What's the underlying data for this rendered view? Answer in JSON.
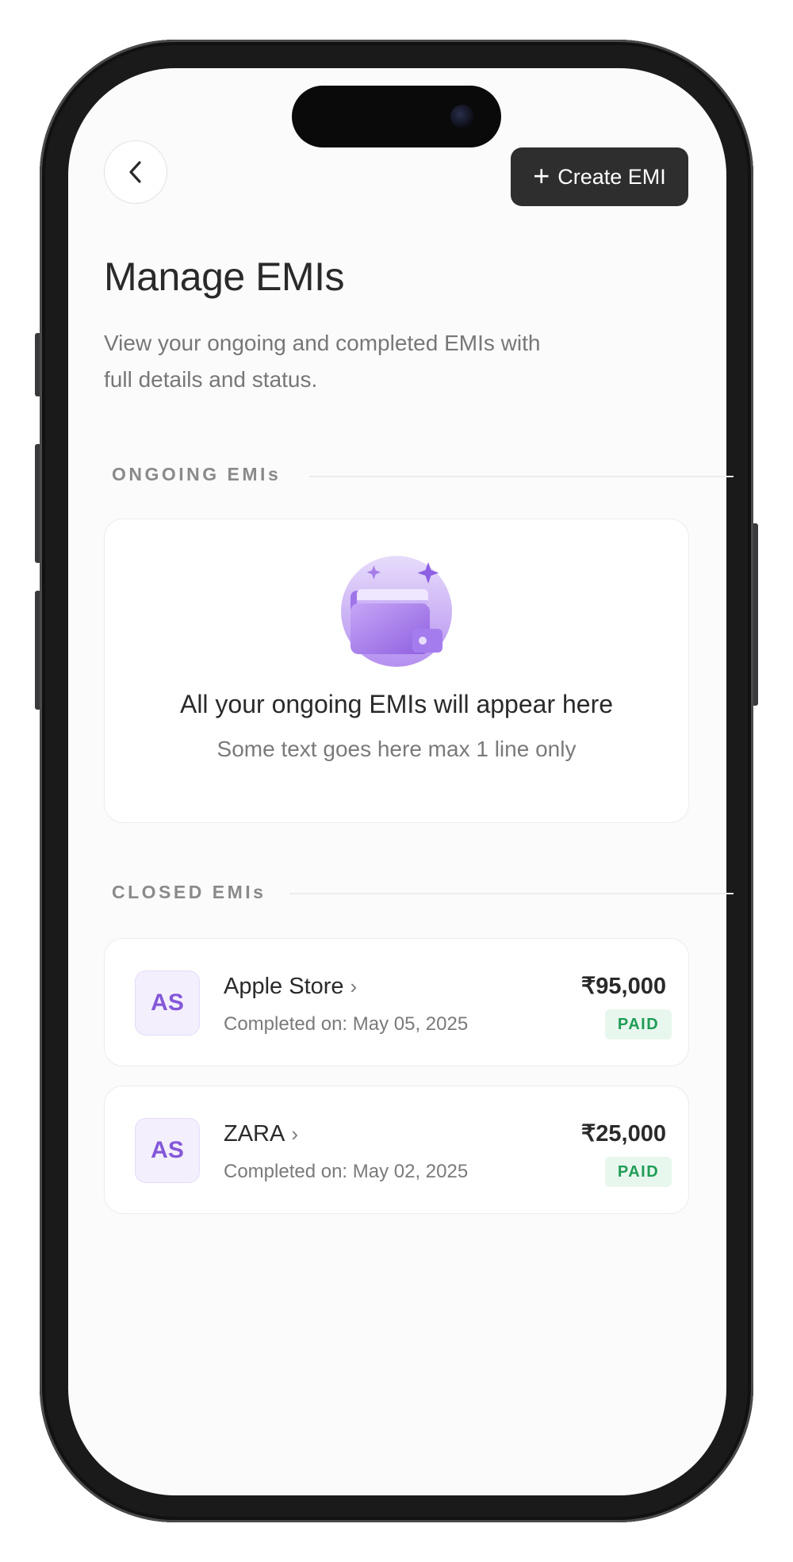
{
  "header": {
    "create_label": "Create EMI",
    "title": "Manage EMIs",
    "subtitle": "View your ongoing and completed EMIs with full details and status."
  },
  "ongoing": {
    "section_label": "ONGOING EMIs",
    "empty_title": "All your ongoing EMIs will appear here",
    "empty_subtitle": "Some text goes here max 1 line only"
  },
  "closed": {
    "section_label": "CLOSED EMIs",
    "items": [
      {
        "initials": "AS",
        "merchant": "Apple Store",
        "completed": "Completed on: May 05, 2025",
        "amount": "₹95,000",
        "status": "PAID"
      },
      {
        "initials": "AS",
        "merchant": "ZARA",
        "completed": "Completed on: May 02, 2025",
        "amount": "₹25,000",
        "status": "PAID"
      }
    ]
  },
  "colors": {
    "accent": "#8458d8",
    "paid_bg": "#e8f7ee",
    "paid_text": "#1f9d55",
    "primary_button": "#2e2e2e"
  },
  "icons": [
    "back-arrow-icon",
    "plus-icon",
    "wallet-card-illustration",
    "chevron-right-icon"
  ]
}
